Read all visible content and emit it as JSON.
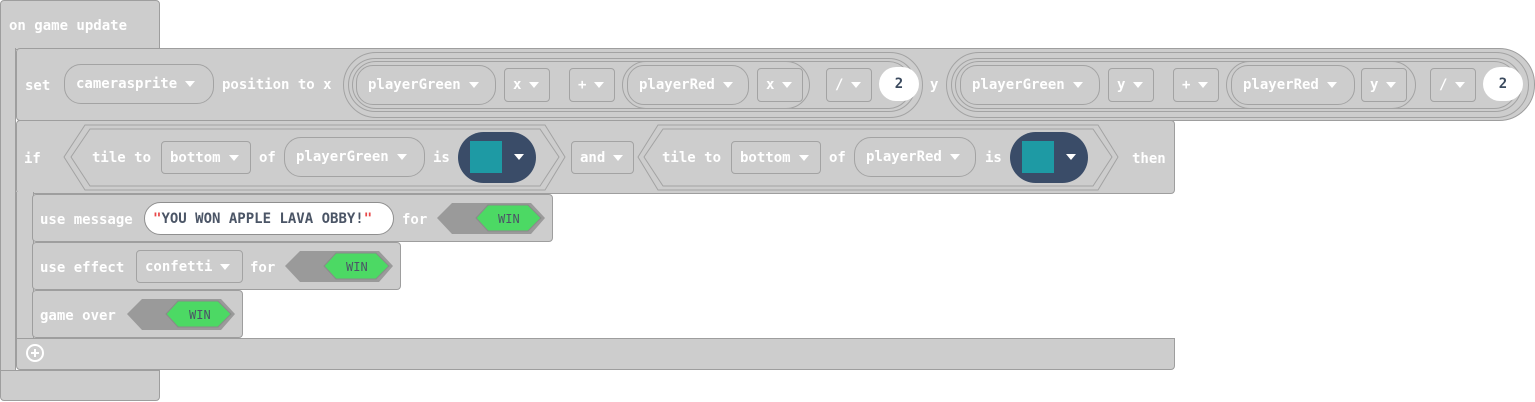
{
  "hat": {
    "label": "on game update"
  },
  "set_block": {
    "label_set": "set",
    "sprite": "camerasprite",
    "label_position": "position to x",
    "label_y": "y",
    "x_expr": {
      "left_sprite": "playerGreen",
      "left_prop": "x",
      "op": "+",
      "right_sprite": "playerRed",
      "right_prop": "x",
      "div_op": "/",
      "divisor": "2"
    },
    "y_expr": {
      "left_sprite": "playerGreen",
      "left_prop": "y",
      "op": "+",
      "right_sprite": "playerRed",
      "right_prop": "y",
      "div_op": "/",
      "divisor": "2"
    }
  },
  "if_block": {
    "label_if": "if",
    "label_then": "then",
    "and_label": "and",
    "cond1": {
      "prefix": "tile to",
      "direction": "bottom",
      "of": "of",
      "sprite": "playerGreen",
      "is": "is"
    },
    "cond2": {
      "prefix": "tile to",
      "direction": "bottom",
      "of": "of",
      "sprite": "playerRed",
      "is": "is"
    }
  },
  "use_message": {
    "label": "use message",
    "quote_open": "\"",
    "text": "YOU WON APPLE LAVA OBBY!",
    "quote_close": "\"",
    "for_label": "for",
    "kind": "WIN"
  },
  "use_effect": {
    "label": "use effect",
    "effect": "confetti",
    "for_label": "for",
    "kind": "WIN"
  },
  "game_over": {
    "label": "game over",
    "kind": "WIN"
  },
  "colors": {
    "block": "#cdcdcd",
    "border": "#9e9e9e",
    "tile_bg": "#3a4c68",
    "kind_green": "#4cd964",
    "kind_gray": "#9a9a9a"
  },
  "icons": [
    "dropdown-caret-icon",
    "tile-image-icon",
    "add-icon"
  ]
}
